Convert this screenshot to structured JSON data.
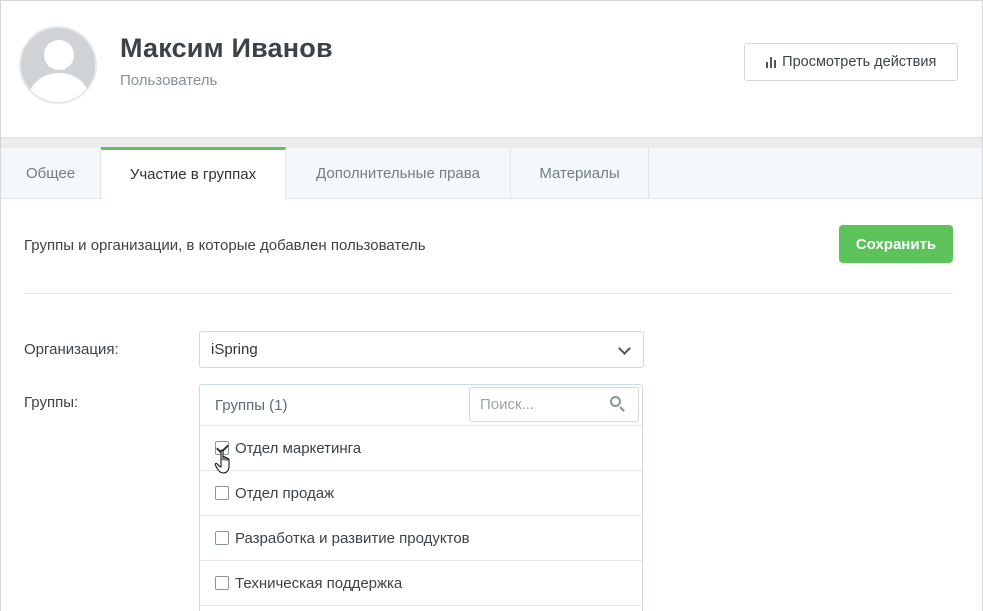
{
  "header": {
    "user_name": "Максим Иванов",
    "user_role": "Пользователь",
    "view_actions_label": "Просмотреть действия",
    "view_actions_icon": "bar-chart-icon"
  },
  "tabs": [
    {
      "label": "Общее",
      "active": false
    },
    {
      "label": "Участие в группах",
      "active": true
    },
    {
      "label": "Дополнительные права",
      "active": false
    },
    {
      "label": "Материалы",
      "active": false
    }
  ],
  "content": {
    "description": "Группы и организации, в которые добавлен пользователь",
    "save_label": "Сохранить",
    "organization_label": "Организация:",
    "organization_value": "iSpring",
    "groups_label": "Группы:"
  },
  "groups_panel": {
    "title": "Группы (1)",
    "search_placeholder": "Поиск...",
    "items": [
      {
        "label": "Отдел маркетинга",
        "checked": true
      },
      {
        "label": "Отдел продаж",
        "checked": false
      },
      {
        "label": "Разработка и развитие продуктов",
        "checked": false
      },
      {
        "label": "Техническая поддержка",
        "checked": false
      }
    ]
  },
  "colors": {
    "accent_green": "#5cc35a",
    "tab_bg": "#f4f8fa",
    "text_dark": "#3d4247"
  }
}
